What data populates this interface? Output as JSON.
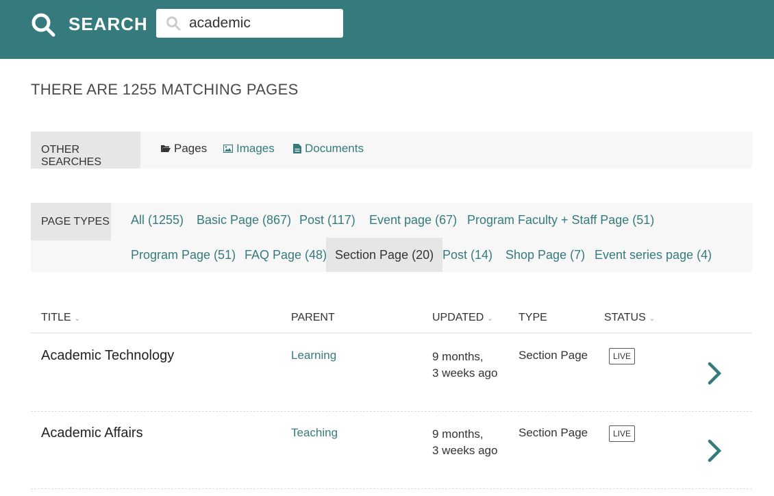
{
  "header": {
    "title": "SEARCH",
    "search_value": "academic",
    "search_placeholder": "Search",
    "brand_color": "#357b7d"
  },
  "results_title": "THERE ARE 1255 MATCHING PAGES",
  "other_searches": {
    "label": "OTHER SEARCHES",
    "links": [
      {
        "label": "Pages",
        "icon": "folder-open-icon",
        "active": true
      },
      {
        "label": "Images",
        "icon": "image-icon",
        "active": false
      },
      {
        "label": "Documents",
        "icon": "document-icon",
        "active": false
      }
    ]
  },
  "page_types": {
    "label": "PAGE TYPES",
    "items": [
      {
        "label": "All (1255)"
      },
      {
        "label": "Basic Page (867)"
      },
      {
        "label": "Post (117)"
      },
      {
        "label": "Event page (67)"
      },
      {
        "label": "Program Faculty + Staff Page (51)"
      },
      {
        "label": "Program Page (51)"
      },
      {
        "label": "FAQ Page (48)"
      },
      {
        "label": "Section Page (20)",
        "active": true
      },
      {
        "label": "Post (14)"
      },
      {
        "label": "Shop Page (7)"
      },
      {
        "label": "Event series page (4)"
      }
    ]
  },
  "table": {
    "columns": [
      {
        "label": "TITLE",
        "sortable": true
      },
      {
        "label": "PARENT",
        "sortable": false
      },
      {
        "label": "UPDATED",
        "sortable": true
      },
      {
        "label": "TYPE",
        "sortable": false
      },
      {
        "label": "STATUS",
        "sortable": true
      }
    ],
    "rows": [
      {
        "title": "Academic Technology",
        "parent": "Learning",
        "updated_line1": "9 months,",
        "updated_line2": "3 weeks ago",
        "type": "Section Page",
        "status": "LIVE"
      },
      {
        "title": "Academic Affairs",
        "parent": "Teaching",
        "updated_line1": "9 months,",
        "updated_line2": "3 weeks ago",
        "type": "Section Page",
        "status": "LIVE"
      }
    ]
  }
}
